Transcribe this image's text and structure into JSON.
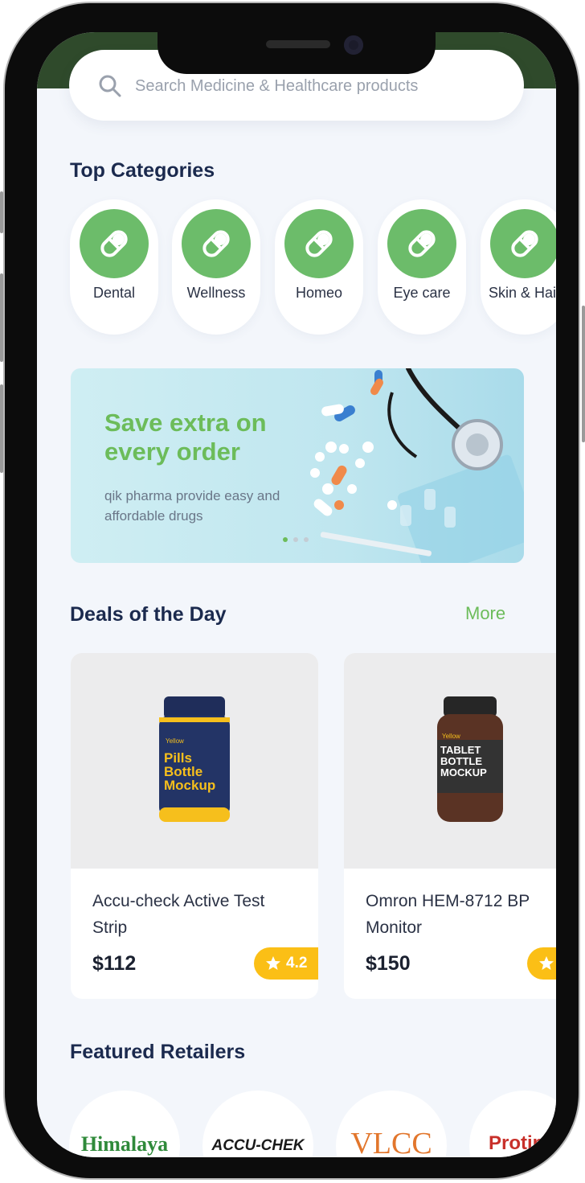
{
  "search": {
    "placeholder": "Search Medicine & Healthcare products"
  },
  "sections": {
    "top_categories": "Top Categories",
    "deals": "Deals of the Day",
    "deals_more": "More",
    "featured": "Featured Retailers"
  },
  "categories": [
    {
      "label": "Dental",
      "icon": "pill-icon"
    },
    {
      "label": "Wellness",
      "icon": "pill-icon"
    },
    {
      "label": "Homeo",
      "icon": "pill-icon"
    },
    {
      "label": "Eye care",
      "icon": "pill-icon"
    },
    {
      "label": "Skin & Hair",
      "icon": "pill-icon"
    }
  ],
  "banner": {
    "title": "Save extra on every order",
    "subtitle": "qik pharma provide easy and affordable drugs",
    "active_dot": 0,
    "dot_count": 3
  },
  "deals": [
    {
      "name": "Accu-check Active Test Strip",
      "price": "$112",
      "rating": "4.2",
      "bottle_brand": "Yellow",
      "bottle_label": "Pills Bottle Mockup"
    },
    {
      "name": "Omron HEM-8712 BP Monitor",
      "price": "$150",
      "rating": "",
      "bottle_brand": "Yellow",
      "bottle_label": "TABLET BOTTLE MOCKUP"
    }
  ],
  "retailers": [
    "Himalaya",
    "ACCU-CHEK",
    "VLCC",
    "Protinex"
  ],
  "colors": {
    "accent_green": "#6cbc6a",
    "rating_yellow": "#fbbf16",
    "title_navy": "#1b2a4e",
    "header_green": "#2f4a2b"
  }
}
